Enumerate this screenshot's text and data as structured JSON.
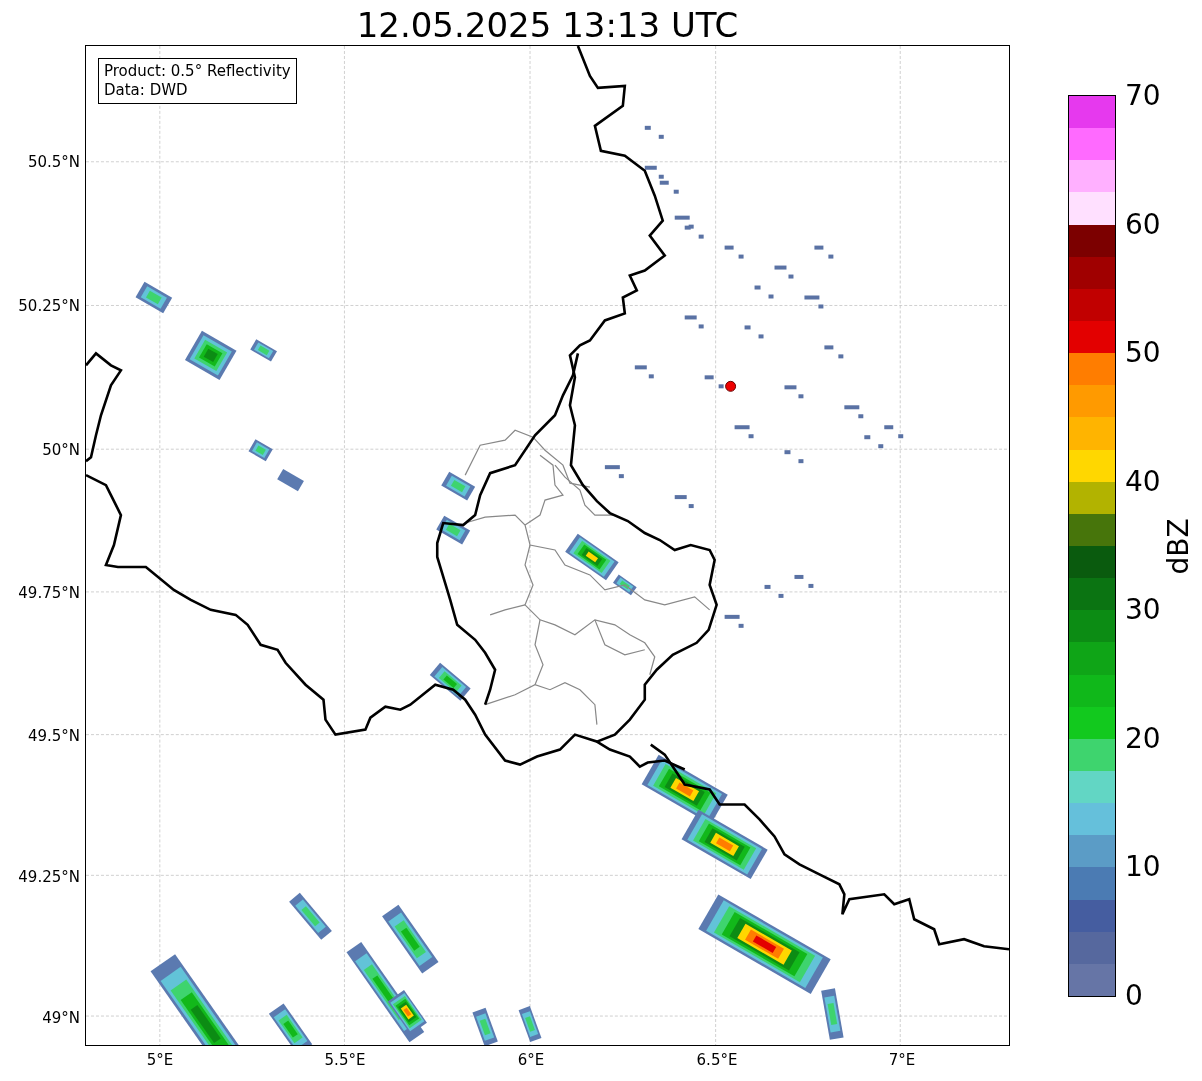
{
  "title": "12.05.2025 13:13 UTC",
  "info_box": {
    "lines": [
      "Product: 0.5° Reflectivity",
      "Data: DWD"
    ]
  },
  "map": {
    "lat_labels": [
      "50.5°N",
      "50.25°N",
      "50°N",
      "49.75°N",
      "49.5°N",
      "49.25°N",
      "49°N"
    ],
    "lon_labels": [
      "5°E",
      "5.5°E",
      "6°E",
      "6.5°E",
      "7°E"
    ]
  },
  "colorbar": {
    "label": "dBZ",
    "ticks": [
      "70",
      "60",
      "50",
      "40",
      "30",
      "20",
      "10",
      "0"
    ],
    "bins": [
      {
        "color": "#6675a6"
      },
      {
        "color": "#56689e"
      },
      {
        "color": "#455da0"
      },
      {
        "color": "#4b7bb3"
      },
      {
        "color": "#5b9cc6"
      },
      {
        "color": "#65c0db"
      },
      {
        "color": "#62d6c4"
      },
      {
        "color": "#3ed46e"
      },
      {
        "color": "#12c91e"
      },
      {
        "color": "#10b81a"
      },
      {
        "color": "#0fa517"
      },
      {
        "color": "#0c8c14"
      },
      {
        "color": "#0b7412"
      },
      {
        "color": "#0a5b0e"
      },
      {
        "color": "#47750b"
      },
      {
        "color": "#b2b300"
      },
      {
        "color": "#ffd700"
      },
      {
        "color": "#ffb400"
      },
      {
        "color": "#ff9a00"
      },
      {
        "color": "#ff7d00"
      },
      {
        "color": "#e30000"
      },
      {
        "color": "#c10000"
      },
      {
        "color": "#a00000"
      },
      {
        "color": "#7c0000"
      },
      {
        "color": "#ffe0ff"
      },
      {
        "color": "#ffb0ff"
      },
      {
        "color": "#ff6aff"
      },
      {
        "color": "#e639ee"
      }
    ]
  }
}
